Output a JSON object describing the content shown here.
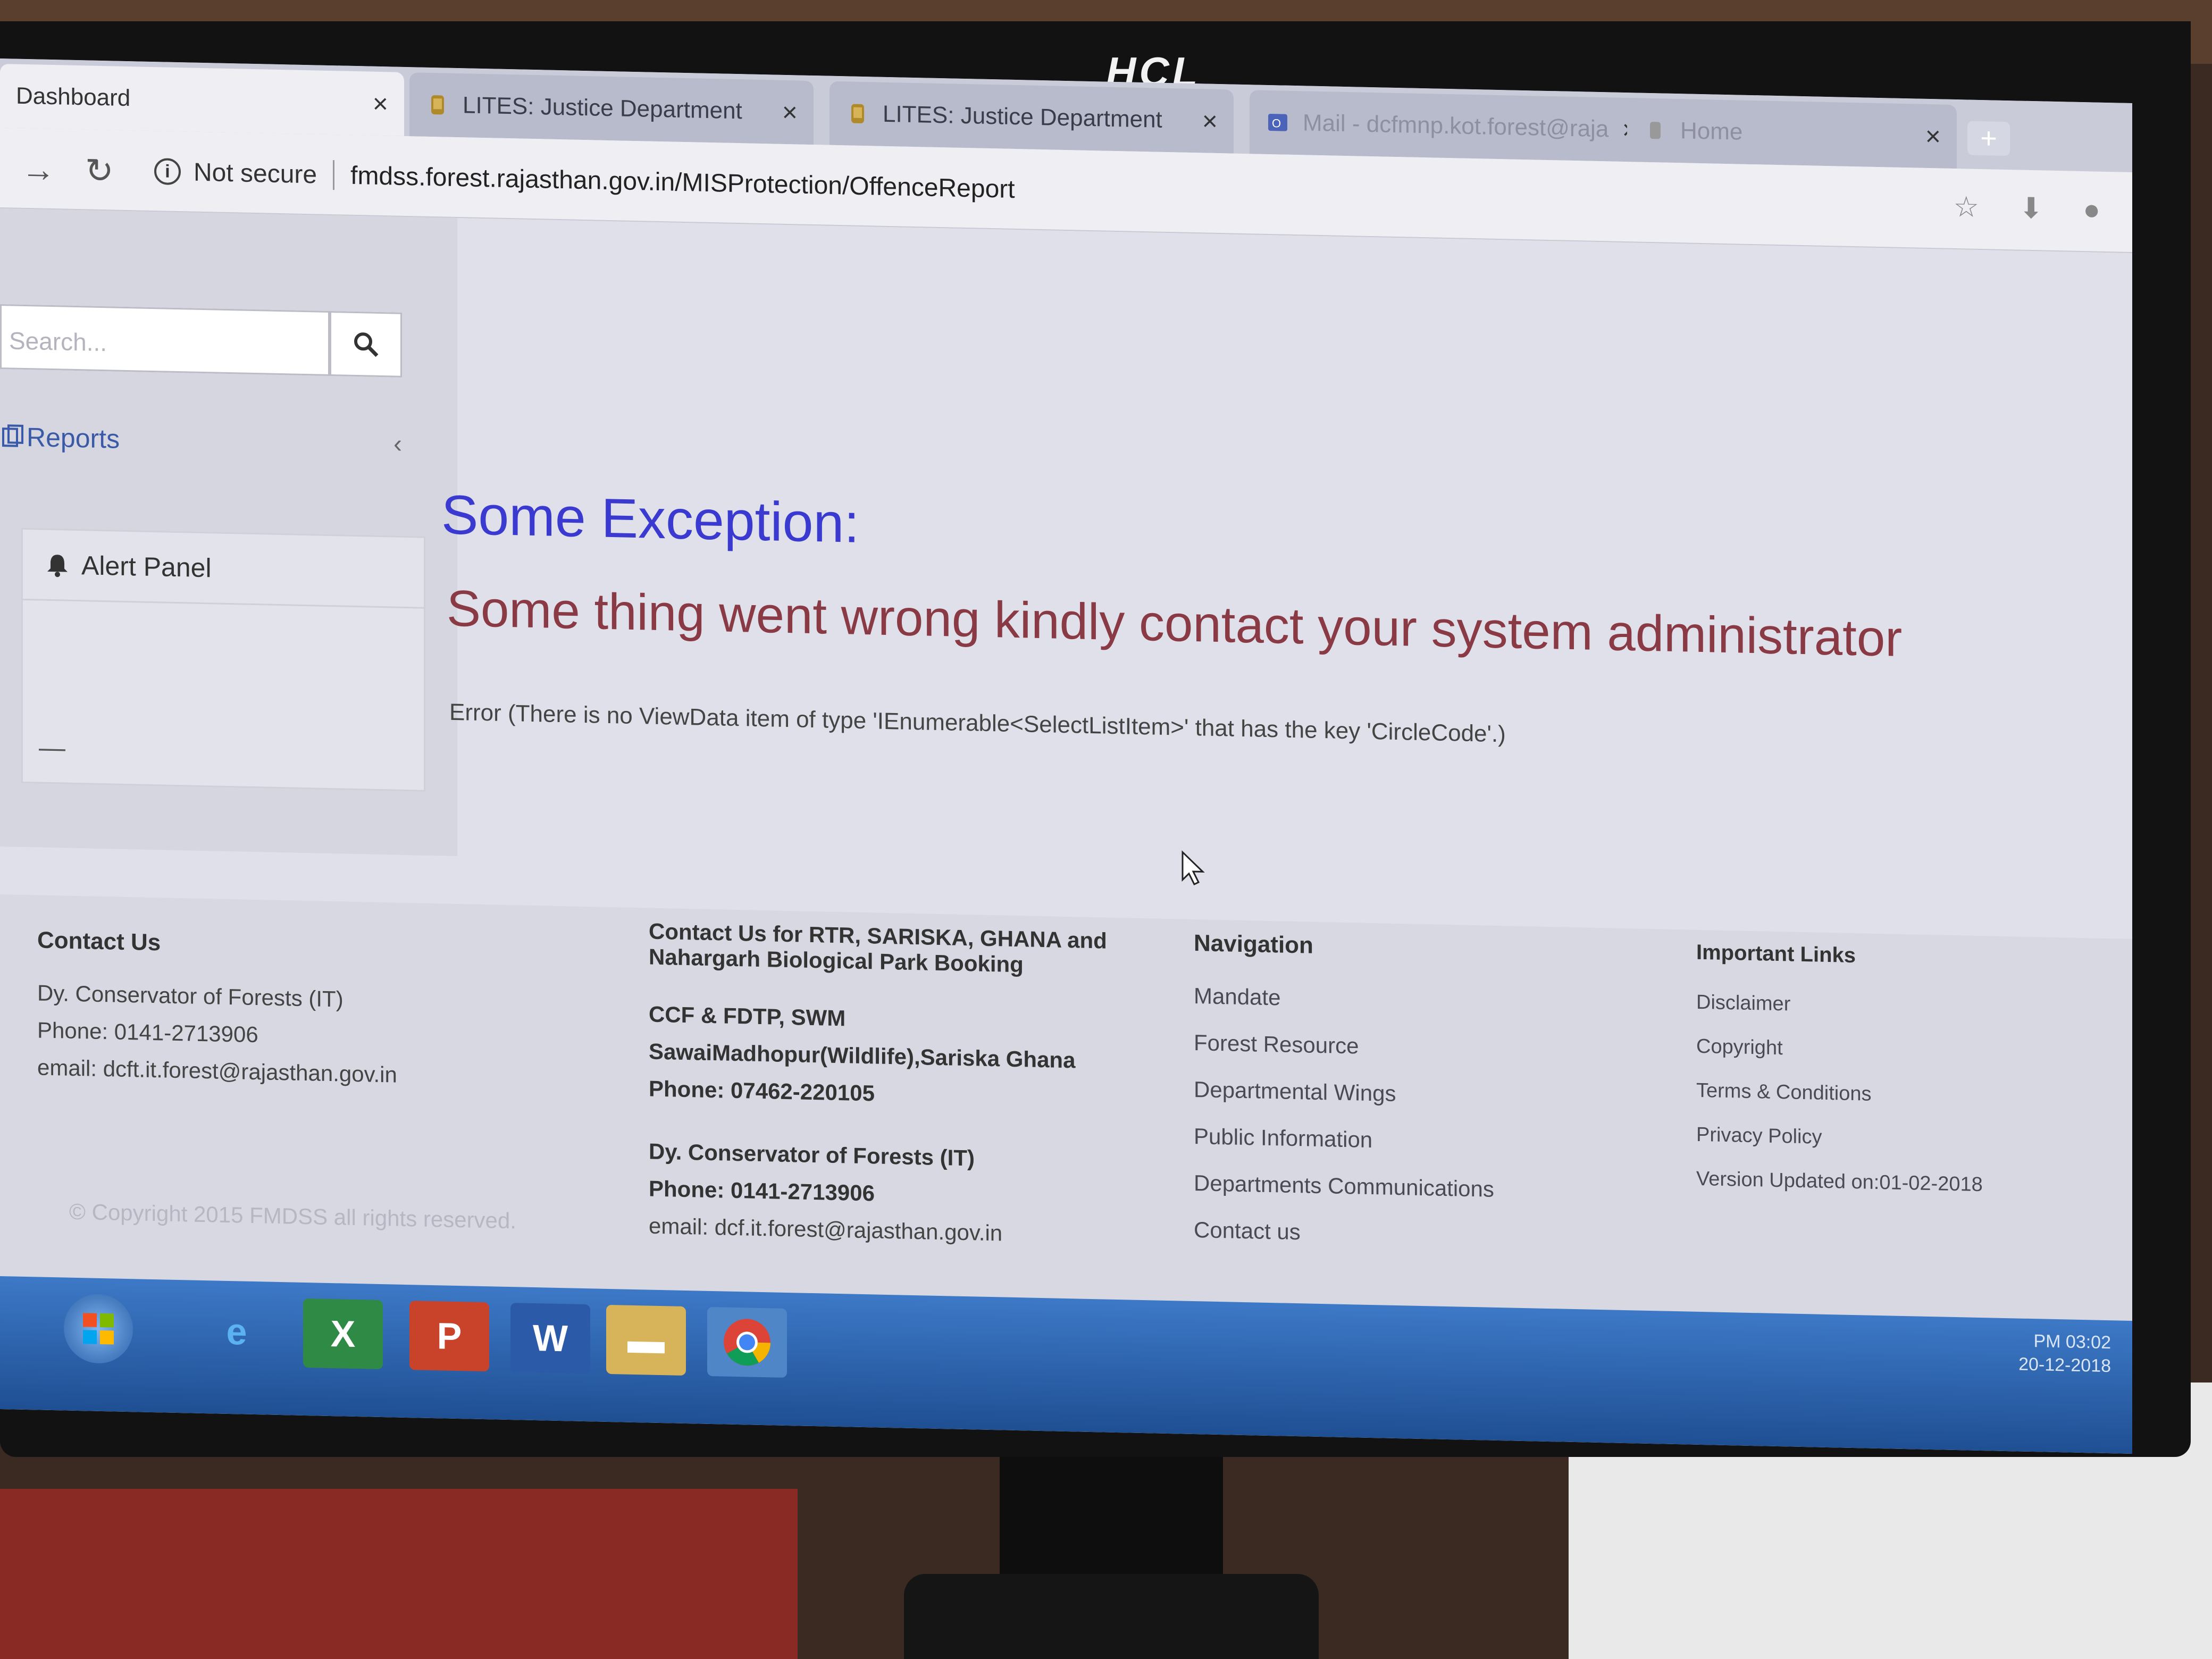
{
  "monitor": {
    "brand": "HCL"
  },
  "browser": {
    "tabs": [
      {
        "title": "Dashboard",
        "active": true
      },
      {
        "title": "LITES: Justice Department",
        "active": false
      },
      {
        "title": "LITES: Justice Department",
        "active": false
      },
      {
        "title": "Mail - dcfmnp.kot.forest@raja",
        "active": false
      },
      {
        "title": "Home",
        "active": false
      }
    ],
    "close_glyph": "×",
    "security_label": "Not secure",
    "url": "fmdss.forest.rajasthan.gov.in/MISProtection/OffenceReport"
  },
  "sidebar": {
    "search_placeholder": "Search...",
    "reports_label": "Reports",
    "alert_panel_title": "Alert Panel",
    "alert_panel_placeholder": "—"
  },
  "main": {
    "exception_title": "Some Exception:",
    "exception_message": "Some thing went wrong kindly contact your system administrator",
    "error_detail": "Error (There is no ViewData item of type 'IEnumerable<SelectListItem>' that has the key 'CircleCode'.)"
  },
  "footer": {
    "contact": {
      "heading": "Contact Us",
      "lines": [
        "Dy. Conservator of Forests (IT)",
        "Phone: 0141-2713906",
        "email: dcft.it.forest@rajasthan.gov.in"
      ]
    },
    "booking": {
      "heading_line1": "Contact Us for RTR, SARISKA, GHANA and",
      "heading_line2": "Nahargarh Biological Park Booking",
      "block1": [
        "CCF & FDTP, SWM",
        "SawaiMadhopur(Wildlife),Sariska Ghana",
        "Phone: 07462-220105"
      ],
      "block2": [
        "Dy. Conservator of Forests (IT)",
        "Phone: 0141-2713906",
        "email: dcf.it.forest@rajasthan.gov.in"
      ]
    },
    "navigation": {
      "heading": "Navigation",
      "links": [
        "Mandate",
        "Forest Resource",
        "Departmental Wings",
        "Public Information",
        "Departments Communications",
        "Contact us"
      ]
    },
    "important_links": {
      "heading": "Important Links",
      "links": [
        "Disclaimer",
        "Copyright",
        "Terms & Conditions",
        "Privacy Policy",
        "Version Updated on:01-02-2018"
      ]
    },
    "copyright": "© Copyright 2015 FMDSS all rights reserved."
  },
  "taskbar": {
    "clock_time": "PM 03:02",
    "clock_date": "20-12-2018",
    "apps": [
      "start",
      "internet-explorer",
      "excel",
      "powerpoint",
      "word",
      "file-explorer",
      "chrome"
    ]
  },
  "colors": {
    "exception_title": "#3a3ad0",
    "exception_message": "#8a3a44",
    "link_blue": "#3a5aa8"
  }
}
